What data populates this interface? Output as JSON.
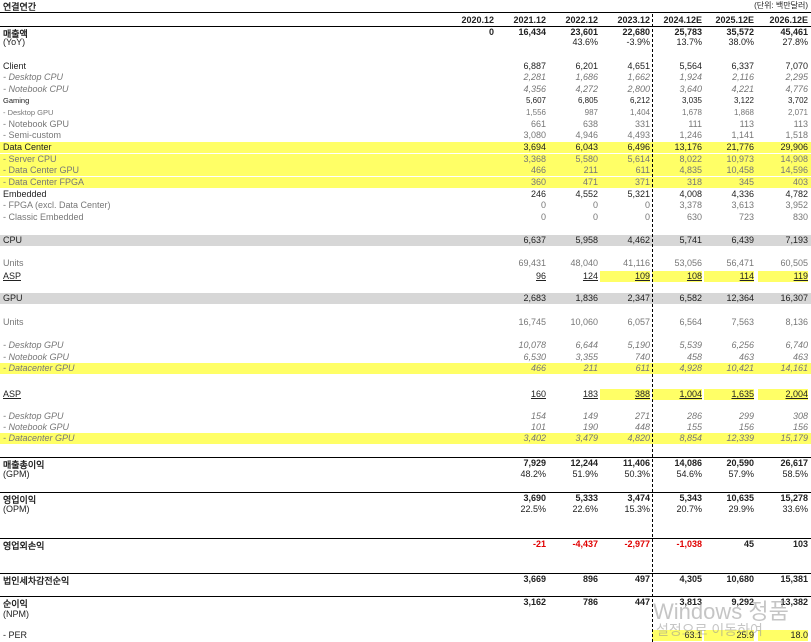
{
  "header": {
    "title": "연결연간",
    "unit": "(단위: 백만달러)"
  },
  "years": [
    "2020.12",
    "2021.12",
    "2022.12",
    "2023.12",
    "2024.12E",
    "2025.12E",
    "2026.12E"
  ],
  "rows": [
    {
      "key": "revenue",
      "label": "매출액",
      "style": "bold",
      "values": [
        "0",
        "16,434",
        "23,601",
        "22,680",
        "25,783",
        "35,572",
        "45,461"
      ]
    },
    {
      "key": "revenue-yoy",
      "label": "(YoY)",
      "values": [
        "",
        "",
        "43.6%",
        "-3.9%",
        "13.7%",
        "38.0%",
        "27.8%"
      ]
    },
    {
      "key": "client",
      "label": "Client",
      "values": [
        "",
        "6,887",
        "6,201",
        "4,651",
        "5,564",
        "6,337",
        "7,070"
      ]
    },
    {
      "key": "client-desktop-cpu",
      "label": " - Desktop CPU",
      "style": "sub ital",
      "values": [
        "",
        "2,281",
        "1,686",
        "1,662",
        "1,924",
        "2,116",
        "2,295"
      ]
    },
    {
      "key": "client-notebook-cpu",
      "label": " - Notebook CPU",
      "style": "sub ital",
      "values": [
        "",
        "4,356",
        "4,272",
        "2,800",
        "3,640",
        "4,221",
        "4,776"
      ]
    },
    {
      "key": "gaming",
      "label": "Gaming",
      "style": "tiny",
      "values": [
        "",
        "5,607",
        "6,805",
        "6,212",
        "3,035",
        "3,122",
        "3,702"
      ]
    },
    {
      "key": "gaming-desktop-gpu",
      "label": " - Desktop GPU",
      "style": "sub tiny",
      "values": [
        "",
        "1,556",
        "987",
        "1,404",
        "1,678",
        "1,868",
        "2,071"
      ]
    },
    {
      "key": "gaming-notebook-gpu",
      "label": " - Notebook GPU",
      "style": "sub",
      "values": [
        "",
        "661",
        "638",
        "331",
        "111",
        "113",
        "113"
      ]
    },
    {
      "key": "gaming-semi-custom",
      "label": " - Semi-custom",
      "style": "sub",
      "values": [
        "",
        "3,080",
        "4,946",
        "4,493",
        "1,246",
        "1,141",
        "1,518"
      ]
    },
    {
      "key": "data-center",
      "label": "Data Center",
      "style": "yellow",
      "values": [
        "",
        "3,694",
        "6,043",
        "6,496",
        "13,176",
        "21,776",
        "29,906"
      ]
    },
    {
      "key": "dc-server-cpu",
      "label": " - Server CPU",
      "style": "yellow sub",
      "values": [
        "",
        "3,368",
        "5,580",
        "5,614",
        "8,022",
        "10,973",
        "14,908"
      ]
    },
    {
      "key": "dc-gpu",
      "label": " - Data Center GPU",
      "style": "yellow sub",
      "values": [
        "",
        "466",
        "211",
        "611",
        "4,835",
        "10,458",
        "14,596"
      ]
    },
    {
      "key": "dc-fpga",
      "label": " - Data Center FPGA",
      "style": "yellow sub",
      "values": [
        "",
        "360",
        "471",
        "371",
        "318",
        "345",
        "403"
      ]
    },
    {
      "key": "embedded",
      "label": "Embedded",
      "values": [
        "",
        "246",
        "4,552",
        "5,321",
        "4,008",
        "4,336",
        "4,782"
      ]
    },
    {
      "key": "emb-fpga",
      "label": " - FPGA (excl. Data Center)",
      "style": "sub",
      "values": [
        "",
        "0",
        "0",
        "0",
        "3,378",
        "3,613",
        "3,952"
      ]
    },
    {
      "key": "emb-classic",
      "label": " - Classic Embedded",
      "style": "sub",
      "values": [
        "",
        "0",
        "0",
        "0",
        "630",
        "723",
        "830"
      ]
    },
    {
      "key": "cpu",
      "label": "CPU",
      "style": "gray",
      "values": [
        "",
        "6,637",
        "5,958",
        "4,462",
        "5,741",
        "6,439",
        "7,193"
      ]
    },
    {
      "key": "cpu-units",
      "label": "Units",
      "style": "sub",
      "values": [
        "",
        "69,431",
        "48,040",
        "41,116",
        "53,056",
        "56,471",
        "60,505"
      ]
    },
    {
      "key": "cpu-asp",
      "label": "ASP",
      "style": "ul",
      "hl": [
        3,
        4,
        5,
        6
      ],
      "values": [
        "",
        "96",
        "124",
        "109",
        "108",
        "114",
        "119"
      ]
    },
    {
      "key": "gpu",
      "label": "GPU",
      "style": "gray",
      "values": [
        "",
        "2,683",
        "1,836",
        "2,347",
        "6,582",
        "12,364",
        "16,307"
      ]
    },
    {
      "key": "gpu-units",
      "label": "Units",
      "style": "sub",
      "values": [
        "",
        "16,745",
        "10,060",
        "6,057",
        "6,564",
        "7,563",
        "8,136"
      ]
    },
    {
      "key": "gpu-units-desktop",
      "label": " - Desktop GPU",
      "style": "sub ital",
      "values": [
        "",
        "10,078",
        "6,644",
        "5,190",
        "5,539",
        "6,256",
        "6,740"
      ]
    },
    {
      "key": "gpu-units-notebook",
      "label": " - Notebook GPU",
      "style": "sub ital",
      "values": [
        "",
        "6,530",
        "3,355",
        "740",
        "458",
        "463",
        "463"
      ]
    },
    {
      "key": "gpu-units-dc",
      "label": " - Datacenter GPU",
      "style": "yellow sub ital",
      "values": [
        "",
        "466",
        "211",
        "611",
        "4,928",
        "10,421",
        "14,161"
      ]
    },
    {
      "key": "gpu-asp",
      "label": "ASP",
      "style": "ul",
      "hl": [
        3,
        4,
        5,
        6
      ],
      "values": [
        "",
        "160",
        "183",
        "388",
        "1,004",
        "1,635",
        "2,004"
      ]
    },
    {
      "key": "gpu-asp-desktop",
      "label": " - Desktop GPU",
      "style": "sub ital",
      "values": [
        "",
        "154",
        "149",
        "271",
        "286",
        "299",
        "308"
      ]
    },
    {
      "key": "gpu-asp-notebook",
      "label": " - Notebook GPU",
      "style": "sub ital",
      "values": [
        "",
        "101",
        "190",
        "448",
        "155",
        "156",
        "156"
      ]
    },
    {
      "key": "gpu-asp-dc",
      "label": " - Datacenter GPU",
      "style": "yellow sub ital",
      "values": [
        "",
        "3,402",
        "3,479",
        "4,820",
        "8,854",
        "12,339",
        "15,179"
      ]
    },
    {
      "key": "gross-profit",
      "label": "매출총이익",
      "style": "bold",
      "values": [
        "",
        "7,929",
        "12,244",
        "11,406",
        "14,086",
        "20,590",
        "26,617"
      ]
    },
    {
      "key": "gpm",
      "label": "(GPM)",
      "values": [
        "",
        "48.2%",
        "51.9%",
        "50.3%",
        "54.6%",
        "57.9%",
        "58.5%"
      ]
    },
    {
      "key": "op-income",
      "label": "영업이익",
      "style": "bold",
      "values": [
        "",
        "3,690",
        "5,333",
        "3,474",
        "5,343",
        "10,635",
        "15,278"
      ]
    },
    {
      "key": "opm",
      "label": "(OPM)",
      "values": [
        "",
        "22.5%",
        "22.6%",
        "15.3%",
        "20.7%",
        "29.9%",
        "33.6%"
      ]
    },
    {
      "key": "non-op",
      "label": "영업외손익",
      "style": "bold",
      "red": [
        1,
        2,
        3,
        4
      ],
      "values": [
        "",
        "-21",
        "-4,437",
        "-2,977",
        "-1,038",
        "45",
        "103"
      ]
    },
    {
      "key": "pretax",
      "label": "법인세차감전순익",
      "style": "bold",
      "values": [
        "",
        "3,669",
        "896",
        "497",
        "4,305",
        "10,680",
        "15,381"
      ]
    },
    {
      "key": "net-income",
      "label": "순이익",
      "style": "bold",
      "values": [
        "",
        "3,162",
        "786",
        "447",
        "3,813",
        "9,292",
        "13,382"
      ]
    },
    {
      "key": "npm",
      "label": "(NPM)",
      "values": [
        "",
        "",
        "",
        "",
        "",
        "",
        ""
      ]
    },
    {
      "key": "per",
      "label": " - PER",
      "hl": [
        4,
        5,
        6
      ],
      "values": [
        "",
        "",
        "",
        "",
        "63.1",
        "25.9",
        "18.0"
      ]
    }
  ],
  "watermark": {
    "line1": "Windows 정품",
    "line2": "설정으로 이동하여"
  }
}
